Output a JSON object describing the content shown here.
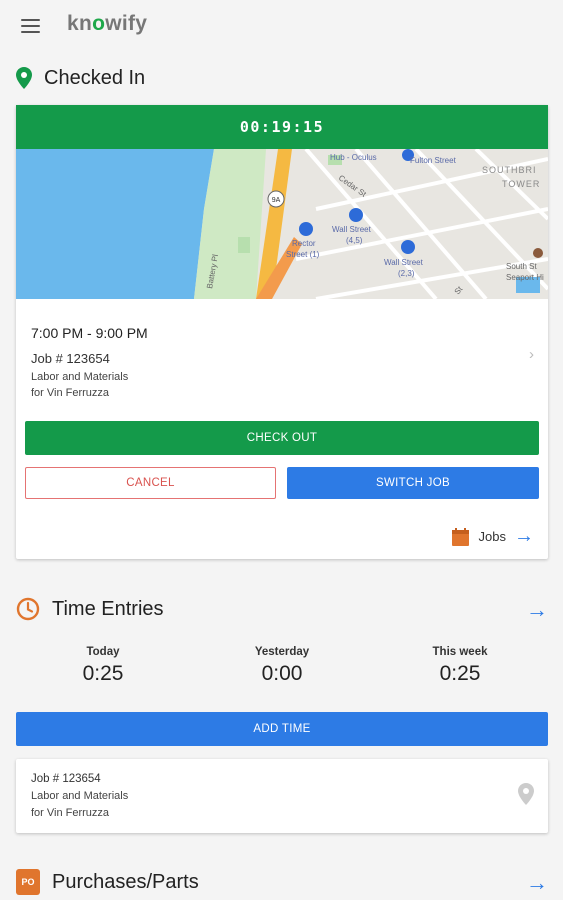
{
  "app": {
    "logo_prefix": "kn",
    "logo_o": "o",
    "logo_suffix": "wify"
  },
  "checked_in": {
    "title": "Checked In",
    "timer": "00:19:15",
    "map_labels": {
      "hub": "Hub - Oculus",
      "fulton": "Fulton Street",
      "cedar": "Cedar St",
      "southbridge": "SOUTHBRI",
      "towers": "TOWER",
      "rector": "Rector",
      "rector_line": "Street (1)",
      "wall1": "Wall Street",
      "wall1_line": "(4,5)",
      "wall2": "Wall Street",
      "wall2_line": "(2,3)",
      "battery": "Battery Pl",
      "south_st": "South St",
      "seaport": "Seaport Hi",
      "st": "St",
      "route": "9A"
    },
    "shift_time": "7:00 PM - 9:00 PM",
    "job_number": "Job # 123654",
    "job_desc": "Labor and Materials",
    "job_client": "for Vin Ferruzza",
    "checkout_label": "CHECK OUT",
    "cancel_label": "CANCEL",
    "switch_label": "SWITCH JOB",
    "jobs_label": "Jobs"
  },
  "time_entries": {
    "title": "Time Entries",
    "stats": [
      {
        "label": "Today",
        "value": "0:25"
      },
      {
        "label": "Yesterday",
        "value": "0:00"
      },
      {
        "label": "This week",
        "value": "0:25"
      }
    ],
    "add_label": "ADD TIME",
    "entry": {
      "job_number": "Job # 123654",
      "desc": "Labor and Materials",
      "client": "for Vin Ferruzza"
    }
  },
  "purchases": {
    "title": "Purchases/Parts",
    "badge": "PO"
  },
  "colors": {
    "green": "#149a4a",
    "blue": "#2d7be5",
    "orange": "#e0752d",
    "red": "#d9534f"
  }
}
